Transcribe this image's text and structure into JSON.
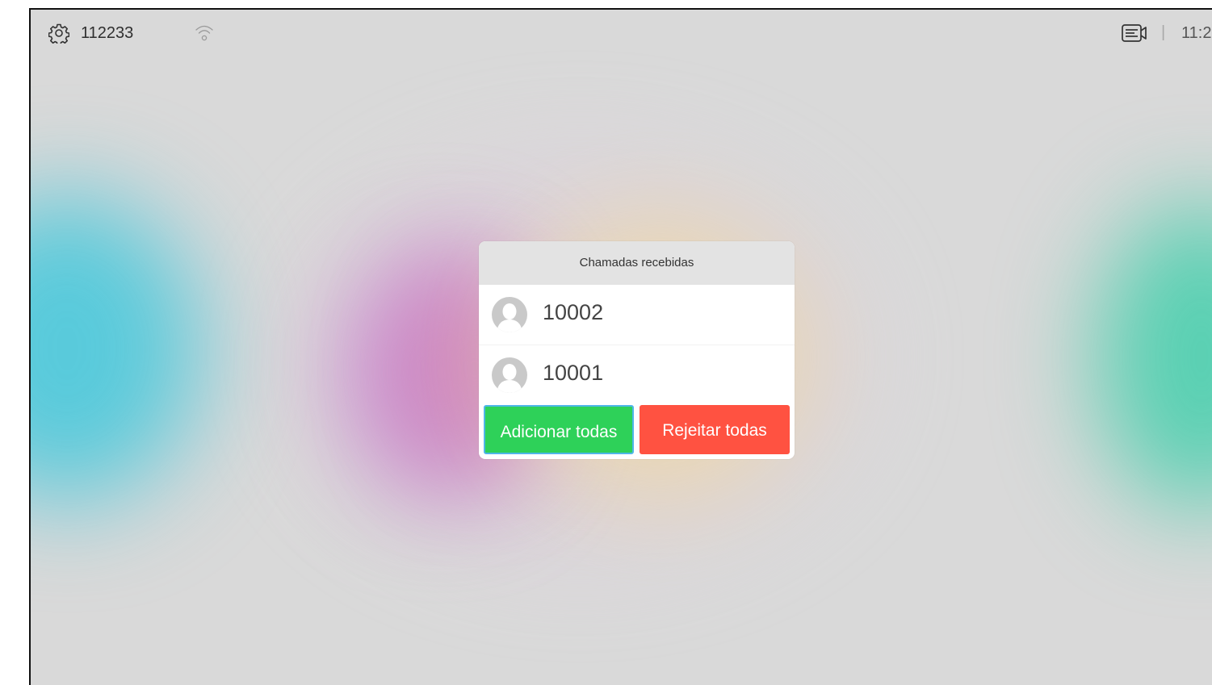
{
  "topbar": {
    "system_number": "112233",
    "separator": "|",
    "clock": "11:2",
    "icons": {
      "settings": "gear-icon",
      "wifi": "wifi-icon",
      "camera": "camera-icon"
    }
  },
  "dialog": {
    "title": "Chamadas recebidas",
    "calls": [
      {
        "number": "10002",
        "icon": "avatar-icon"
      },
      {
        "number": "10001",
        "icon": "avatar-icon"
      }
    ],
    "accept_all_label": "Adicionar todas",
    "reject_all_label": "Rejeitar todas"
  },
  "colors": {
    "accept": "#2ed159",
    "reject": "#ff5241",
    "focus_outline": "#4fb6e8",
    "background": "#d9d9d9"
  }
}
